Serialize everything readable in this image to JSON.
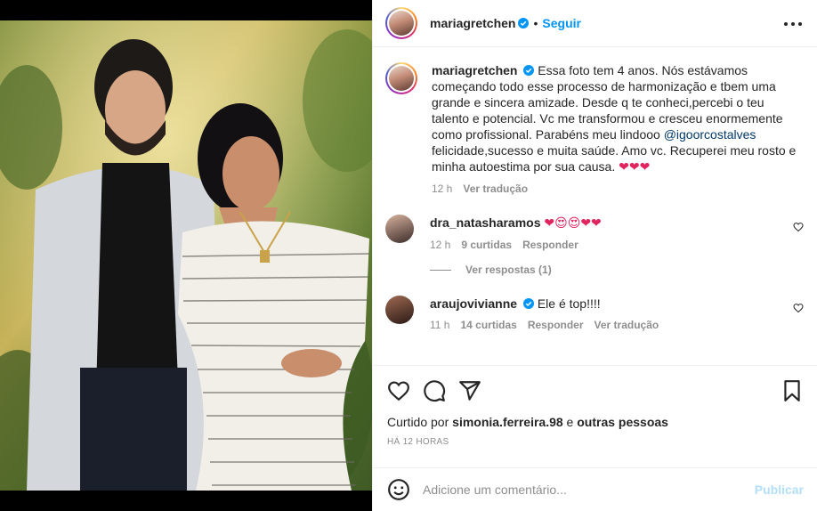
{
  "header": {
    "username": "mariagretchen",
    "separator": "•",
    "follow_label": "Seguir"
  },
  "caption": {
    "username": "mariagretchen",
    "text_before_mention": "Essa foto tem 4 anos. Nós estávamos começando todo esse processo de harmonização e tbem uma grande e sincera amizade. Desde q te conheci,percebi o teu talento e potencial. Vc me transformou e cresceu enormemente como profissional. Parabéns meu lindooo ",
    "mention": "@igoorcostalves",
    "text_after_mention": " felicidade,sucesso e muita saúde. Amo vc. Recuperei meu rosto e minha autoestima por sua causa. ",
    "emojis": "❤❤❤",
    "time": "12 h",
    "translate": "Ver tradução"
  },
  "comments": [
    {
      "username": "dra_natasharamos",
      "text": "❤😍😍❤❤",
      "time": "12 h",
      "likes": "9 curtidas",
      "reply": "Responder",
      "view_replies": "Ver respostas (1)"
    },
    {
      "username": "araujovivianne",
      "text": "Ele é top!!!!",
      "time": "11 h",
      "likes": "14 curtidas",
      "reply": "Responder",
      "translate": "Ver tradução"
    }
  ],
  "likes": {
    "prefix": "Curtido por ",
    "user": "simonia.ferreira.98",
    "middle": " e ",
    "others": "outras pessoas"
  },
  "timestamp": "HÁ 12 HORAS",
  "add_comment": {
    "placeholder": "Adicione um comentário...",
    "publish_label": "Publicar"
  },
  "colors": {
    "link": "#0095f6",
    "publish_disabled": "#b2dffc",
    "muted": "#8e8e8e",
    "heart": "#e0245e"
  }
}
